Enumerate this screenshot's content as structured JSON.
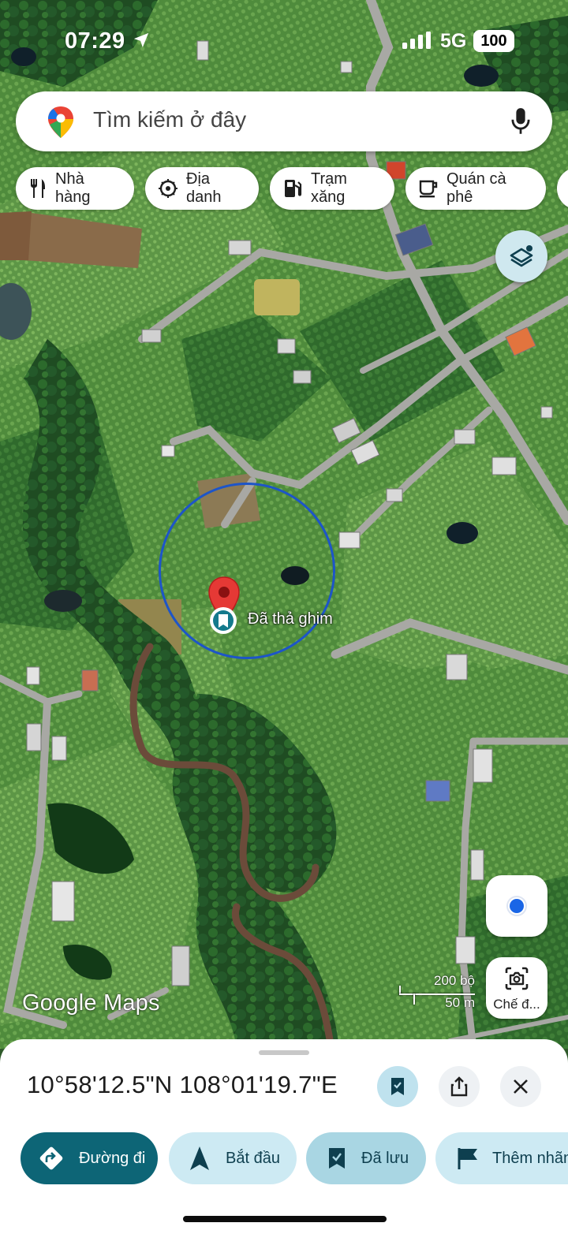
{
  "status_bar": {
    "time": "07:29",
    "network": "5G",
    "battery": "100"
  },
  "search": {
    "placeholder": "Tìm kiếm ở đây"
  },
  "chips": [
    {
      "label": "Nhà hàng",
      "icon": "fork-knife-icon"
    },
    {
      "label": "Địa danh",
      "icon": "landmark-icon"
    },
    {
      "label": "Trạm xăng",
      "icon": "gas-station-icon"
    },
    {
      "label": "Quán cà phê",
      "icon": "coffee-icon"
    }
  ],
  "map": {
    "pin_label": "Đã thả ghim",
    "watermark": "Google Maps",
    "scale_top": "200 bộ",
    "scale_bottom": "50 m",
    "lens_label": "Chế đ...",
    "accent": "#1d55c8",
    "pin_color": "#e53935"
  },
  "sheet": {
    "coordinates": "10°58'12.5\"N 108°01'19.7\"E",
    "actions": [
      {
        "label": "Đường đi",
        "icon": "directions-icon"
      },
      {
        "label": "Bắt đầu",
        "icon": "navigation-arrow-icon"
      },
      {
        "label": "Đã lưu",
        "icon": "bookmark-icon"
      },
      {
        "label": "Thêm nhãn",
        "icon": "flag-icon"
      }
    ]
  }
}
